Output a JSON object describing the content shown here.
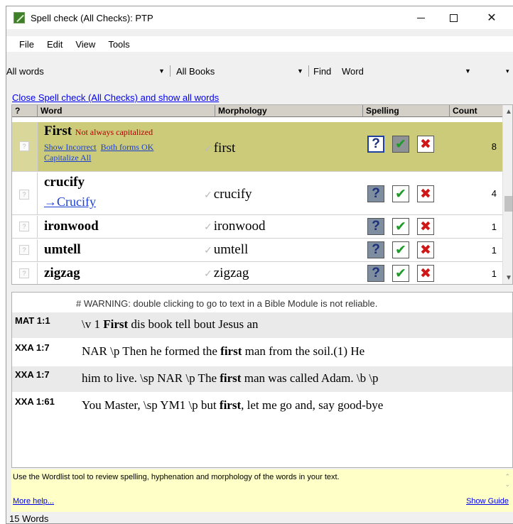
{
  "window": {
    "title": "Spell check (All Checks): PTP"
  },
  "menu": [
    "File",
    "Edit",
    "View",
    "Tools"
  ],
  "filters": {
    "scope": "All words",
    "books": "All Books",
    "find_label": "Find",
    "find_value": "Word"
  },
  "close_link": "Close Spell check (All Checks) and show all words",
  "table": {
    "headers": {
      "q": "?",
      "word": "Word",
      "morphology": "Morphology",
      "spelling": "Spelling",
      "count": "Count"
    },
    "rows": [
      {
        "word": "First",
        "warning": "Not always capitalized",
        "links": [
          "Show Incorrect",
          "Both forms OK",
          "Capitalize All"
        ],
        "morph": "first",
        "count": "8",
        "selected": true
      },
      {
        "word": "crucify",
        "suggestion": "→Crucify",
        "morph": "crucify",
        "count": "4"
      },
      {
        "word": "ironwood",
        "morph": "ironwood",
        "count": "1"
      },
      {
        "word": "umtell",
        "morph": "umtell",
        "count": "1"
      },
      {
        "word": "zigzag",
        "morph": "zigzag",
        "count": "1"
      }
    ]
  },
  "concordance": {
    "warning": "# WARNING: double clicking to go to text in a Bible Module is not reliable.",
    "rows": [
      {
        "ref": "MAT 1:1",
        "before": "\\v 1 ",
        "hit": "First",
        "after": " dis book tell bout Jesus an"
      },
      {
        "ref": "XXA 1:7",
        "before": "NAR \\p Then he formed the ",
        "hit": "first",
        "after": " man from the soil.(1) He"
      },
      {
        "ref": "XXA 1:7",
        "before": "him to live. \\sp NAR \\p The ",
        "hit": "first",
        "after": " man was called Adam. \\b \\p"
      },
      {
        "ref": "XXA 1:61",
        "before": "You Master, \\sp YM1 \\p but ",
        "hit": "first",
        "after": ", let me go and, say good-bye"
      }
    ]
  },
  "guide": {
    "text": "Use the Wordlist tool to review spelling, hyphenation and morphology of the words in your text.",
    "more_help": "More help...",
    "show_guide": "Show Guide"
  },
  "status": "15 Words"
}
